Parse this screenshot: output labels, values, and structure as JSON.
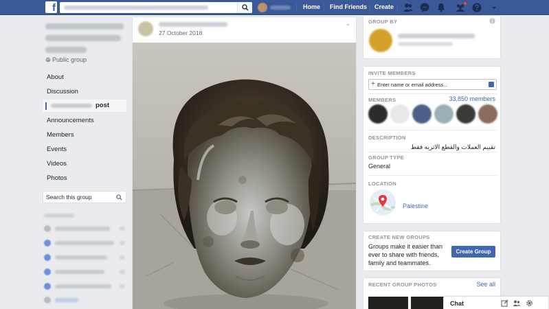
{
  "topbar": {
    "logo_letter": "f",
    "nav": [
      "Home",
      "Find Friends",
      "Create"
    ]
  },
  "group": {
    "privacy": "Public group",
    "nav": [
      "About",
      "Discussion",
      "Announcements",
      "Members",
      "Events",
      "Videos",
      "Photos"
    ],
    "active_suffix": "post",
    "search_placeholder": "Search this group"
  },
  "post": {
    "date": "27 October 2018",
    "menu_glyph": "⌄"
  },
  "sidebar": {
    "group_by_heading": "GROUP BY",
    "invite_heading": "INVITE MEMBERS",
    "invite_placeholder": "Enter name or email address...",
    "members_heading": "MEMBERS",
    "members_count": "33,850 members",
    "description_heading": "DESCRIPTION",
    "description_text": "تقييم العملات والقطع الاثريه فقط",
    "group_type_heading": "GROUP TYPE",
    "group_type_value": "General",
    "location_heading": "LOCATION",
    "location_value": "Palestine",
    "create_heading": "CREATE NEW GROUPS",
    "create_text": [
      "Groups make it easier than",
      "ever to share with friends,",
      "family and teammates."
    ],
    "create_button": "Create Group",
    "photos_heading": "RECENT GROUP PHOTOS",
    "see_all": "See all"
  },
  "chat": {
    "label": "Chat"
  },
  "colors": {
    "brand": "#3b5998",
    "button": "#4267b2",
    "background": "#e9ebee"
  }
}
